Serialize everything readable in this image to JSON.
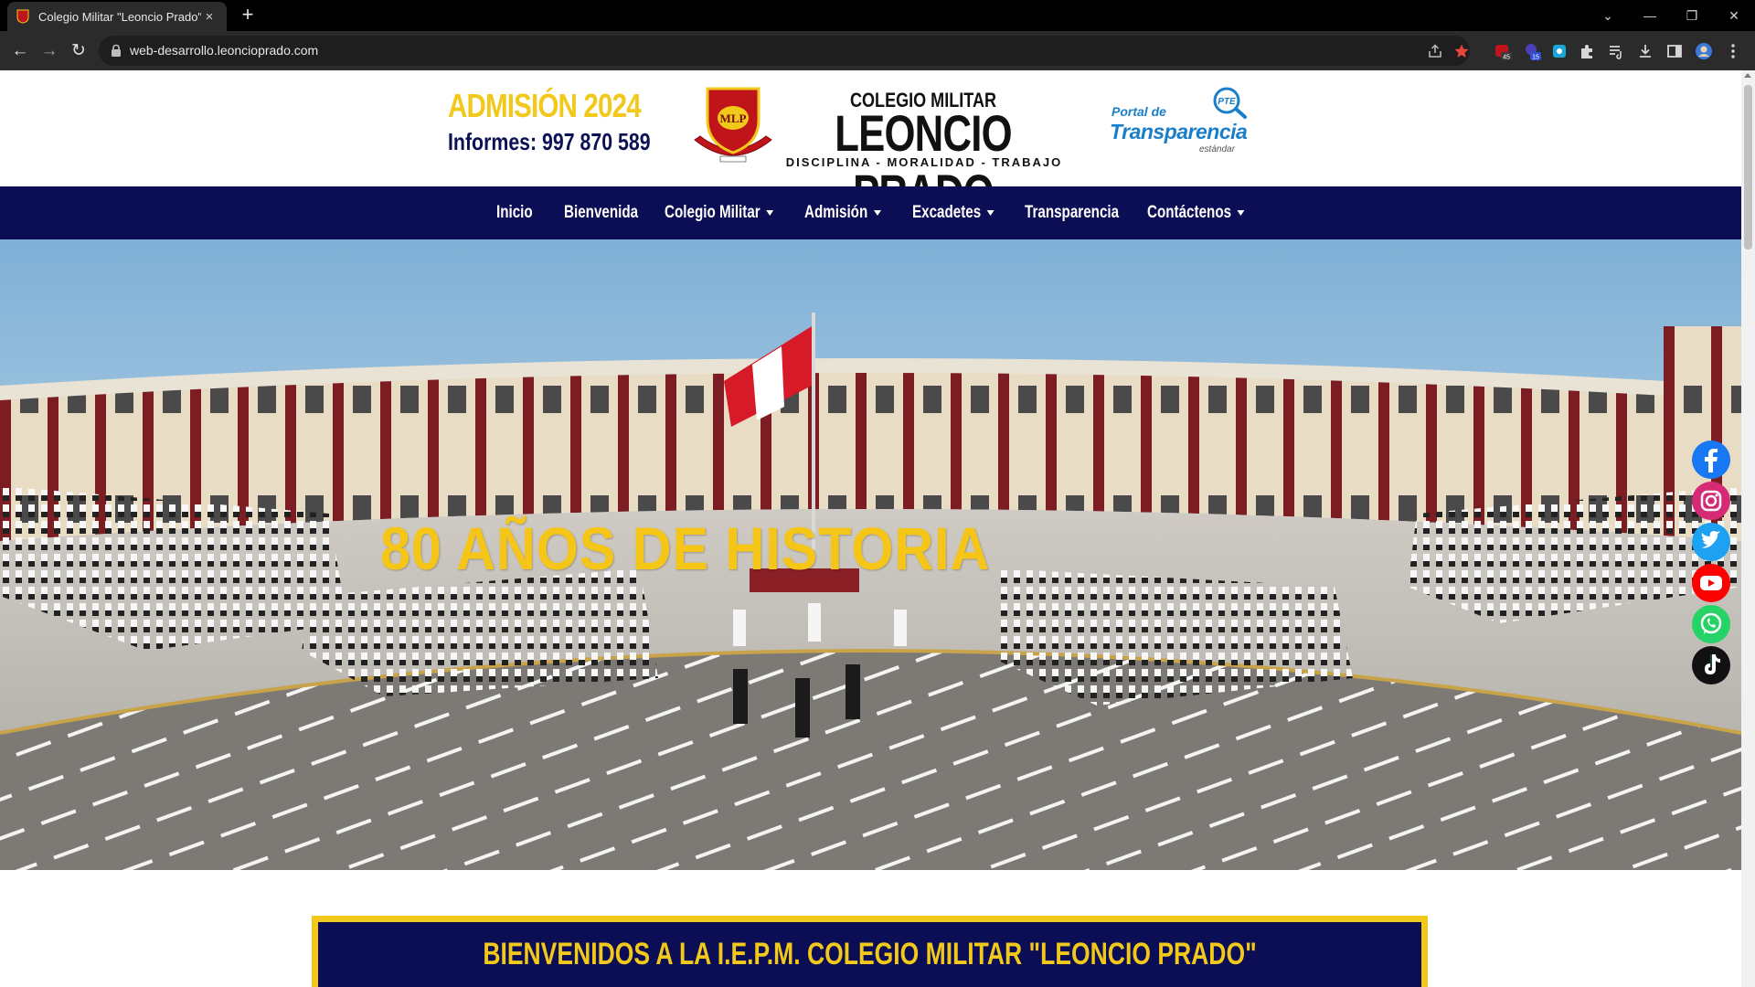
{
  "browser": {
    "tab_title": "Colegio Militar \"Leoncio Prado\"",
    "tab_close": "×",
    "new_tab": "+",
    "url": "web-desarrollo.leoncioprado.com",
    "controls": {
      "chevron": "⌄",
      "minimize": "—",
      "restore": "❐",
      "close": "✕"
    },
    "nav": {
      "back": "←",
      "forward": "→",
      "reload": "↻"
    },
    "extension_badges": [
      "45",
      "15"
    ]
  },
  "header": {
    "admision": "ADMISIÓN 2024",
    "informes": "Informes: 997 870 589",
    "crest_text": "MLP",
    "brand_sub": "COLEGIO MILITAR",
    "brand_main": "LEONCIO PRADO",
    "brand_motto": "DISCIPLINA - MORALIDAD - TRABAJO",
    "pte_badge": "PTE",
    "pte_line1": "Portal de",
    "pte_line2": "Transparencia",
    "pte_line3": "estándar"
  },
  "navbar": {
    "items": [
      {
        "label": "Inicio",
        "dropdown": false
      },
      {
        "label": "Bienvenida",
        "dropdown": false
      },
      {
        "label": "Colegio Militar",
        "dropdown": true
      },
      {
        "label": "Admisión",
        "dropdown": true
      },
      {
        "label": "Excadetes",
        "dropdown": true
      },
      {
        "label": "Transparencia",
        "dropdown": false
      },
      {
        "label": "Contáctenos",
        "dropdown": true
      }
    ]
  },
  "hero": {
    "title": "80 AÑOS DE HISTORIA"
  },
  "social": [
    "facebook",
    "instagram",
    "twitter",
    "youtube",
    "whatsapp",
    "tiktok"
  ],
  "welcome": {
    "title": "BIENVENIDOS A LA I.E.P.M. COLEGIO MILITAR \"LEONCIO PRADO\""
  },
  "colors": {
    "navy": "#0b0e55",
    "gold": "#f2c81a",
    "hero_title": "#f5c518",
    "transparencia_blue": "#1a7fc9"
  }
}
